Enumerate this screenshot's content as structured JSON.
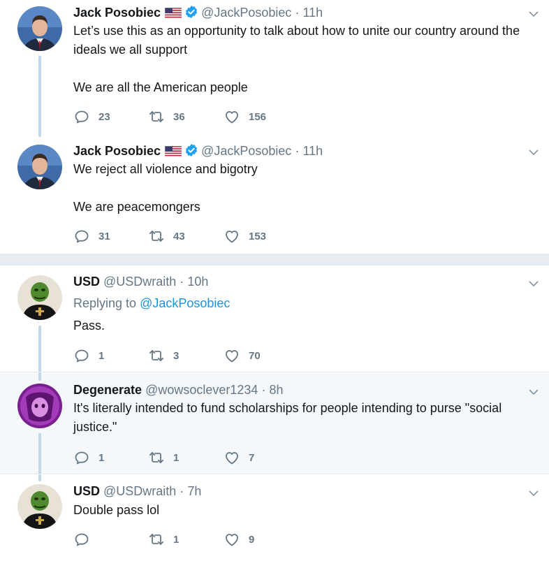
{
  "tweets": [
    {
      "name": "Jack Posobiec",
      "handle": "@JackPosobiec",
      "dot": "·",
      "time": "11h",
      "text": "Let’s use this as an opportunity to talk about how to unite our country around the ideals we all support\n\nWe are all the American people",
      "replies": "23",
      "retweets": "36",
      "likes": "156"
    },
    {
      "name": "Jack Posobiec",
      "handle": "@JackPosobiec",
      "dot": "·",
      "time": "11h",
      "text": "We reject all violence and bigotry\n\nWe are peacemongers",
      "replies": "31",
      "retweets": "43",
      "likes": "153"
    },
    {
      "name": "USD",
      "handle": "@USDwraith",
      "dot": "·",
      "time": "10h",
      "reply_prefix": "Replying to",
      "reply_target": "@JackPosobiec",
      "text": "Pass.",
      "replies": "1",
      "retweets": "3",
      "likes": "70"
    },
    {
      "name": "Degenerate",
      "handle": "@wowsoclever1234",
      "dot": "·",
      "time": "8h",
      "text": "It's literally intended to fund scholarships for people intending to purse \"social justice.\"",
      "replies": "1",
      "retweets": "1",
      "likes": "7"
    },
    {
      "name": "USD",
      "handle": "@USDwraith",
      "dot": "·",
      "time": "7h",
      "text": "Double pass lol",
      "replies": "",
      "retweets": "1",
      "likes": "9"
    }
  ],
  "colors": {
    "text": "#14171a",
    "secondary": "#657786",
    "link": "#1b95e0",
    "verified": "#1da1f2",
    "thread_line": "#c4d7e8",
    "highlight_bg": "#f5f8fa"
  },
  "icons": [
    "reply-icon",
    "retweet-icon",
    "like-icon",
    "chevron-down-icon",
    "verified-badge-icon",
    "us-flag-icon"
  ]
}
